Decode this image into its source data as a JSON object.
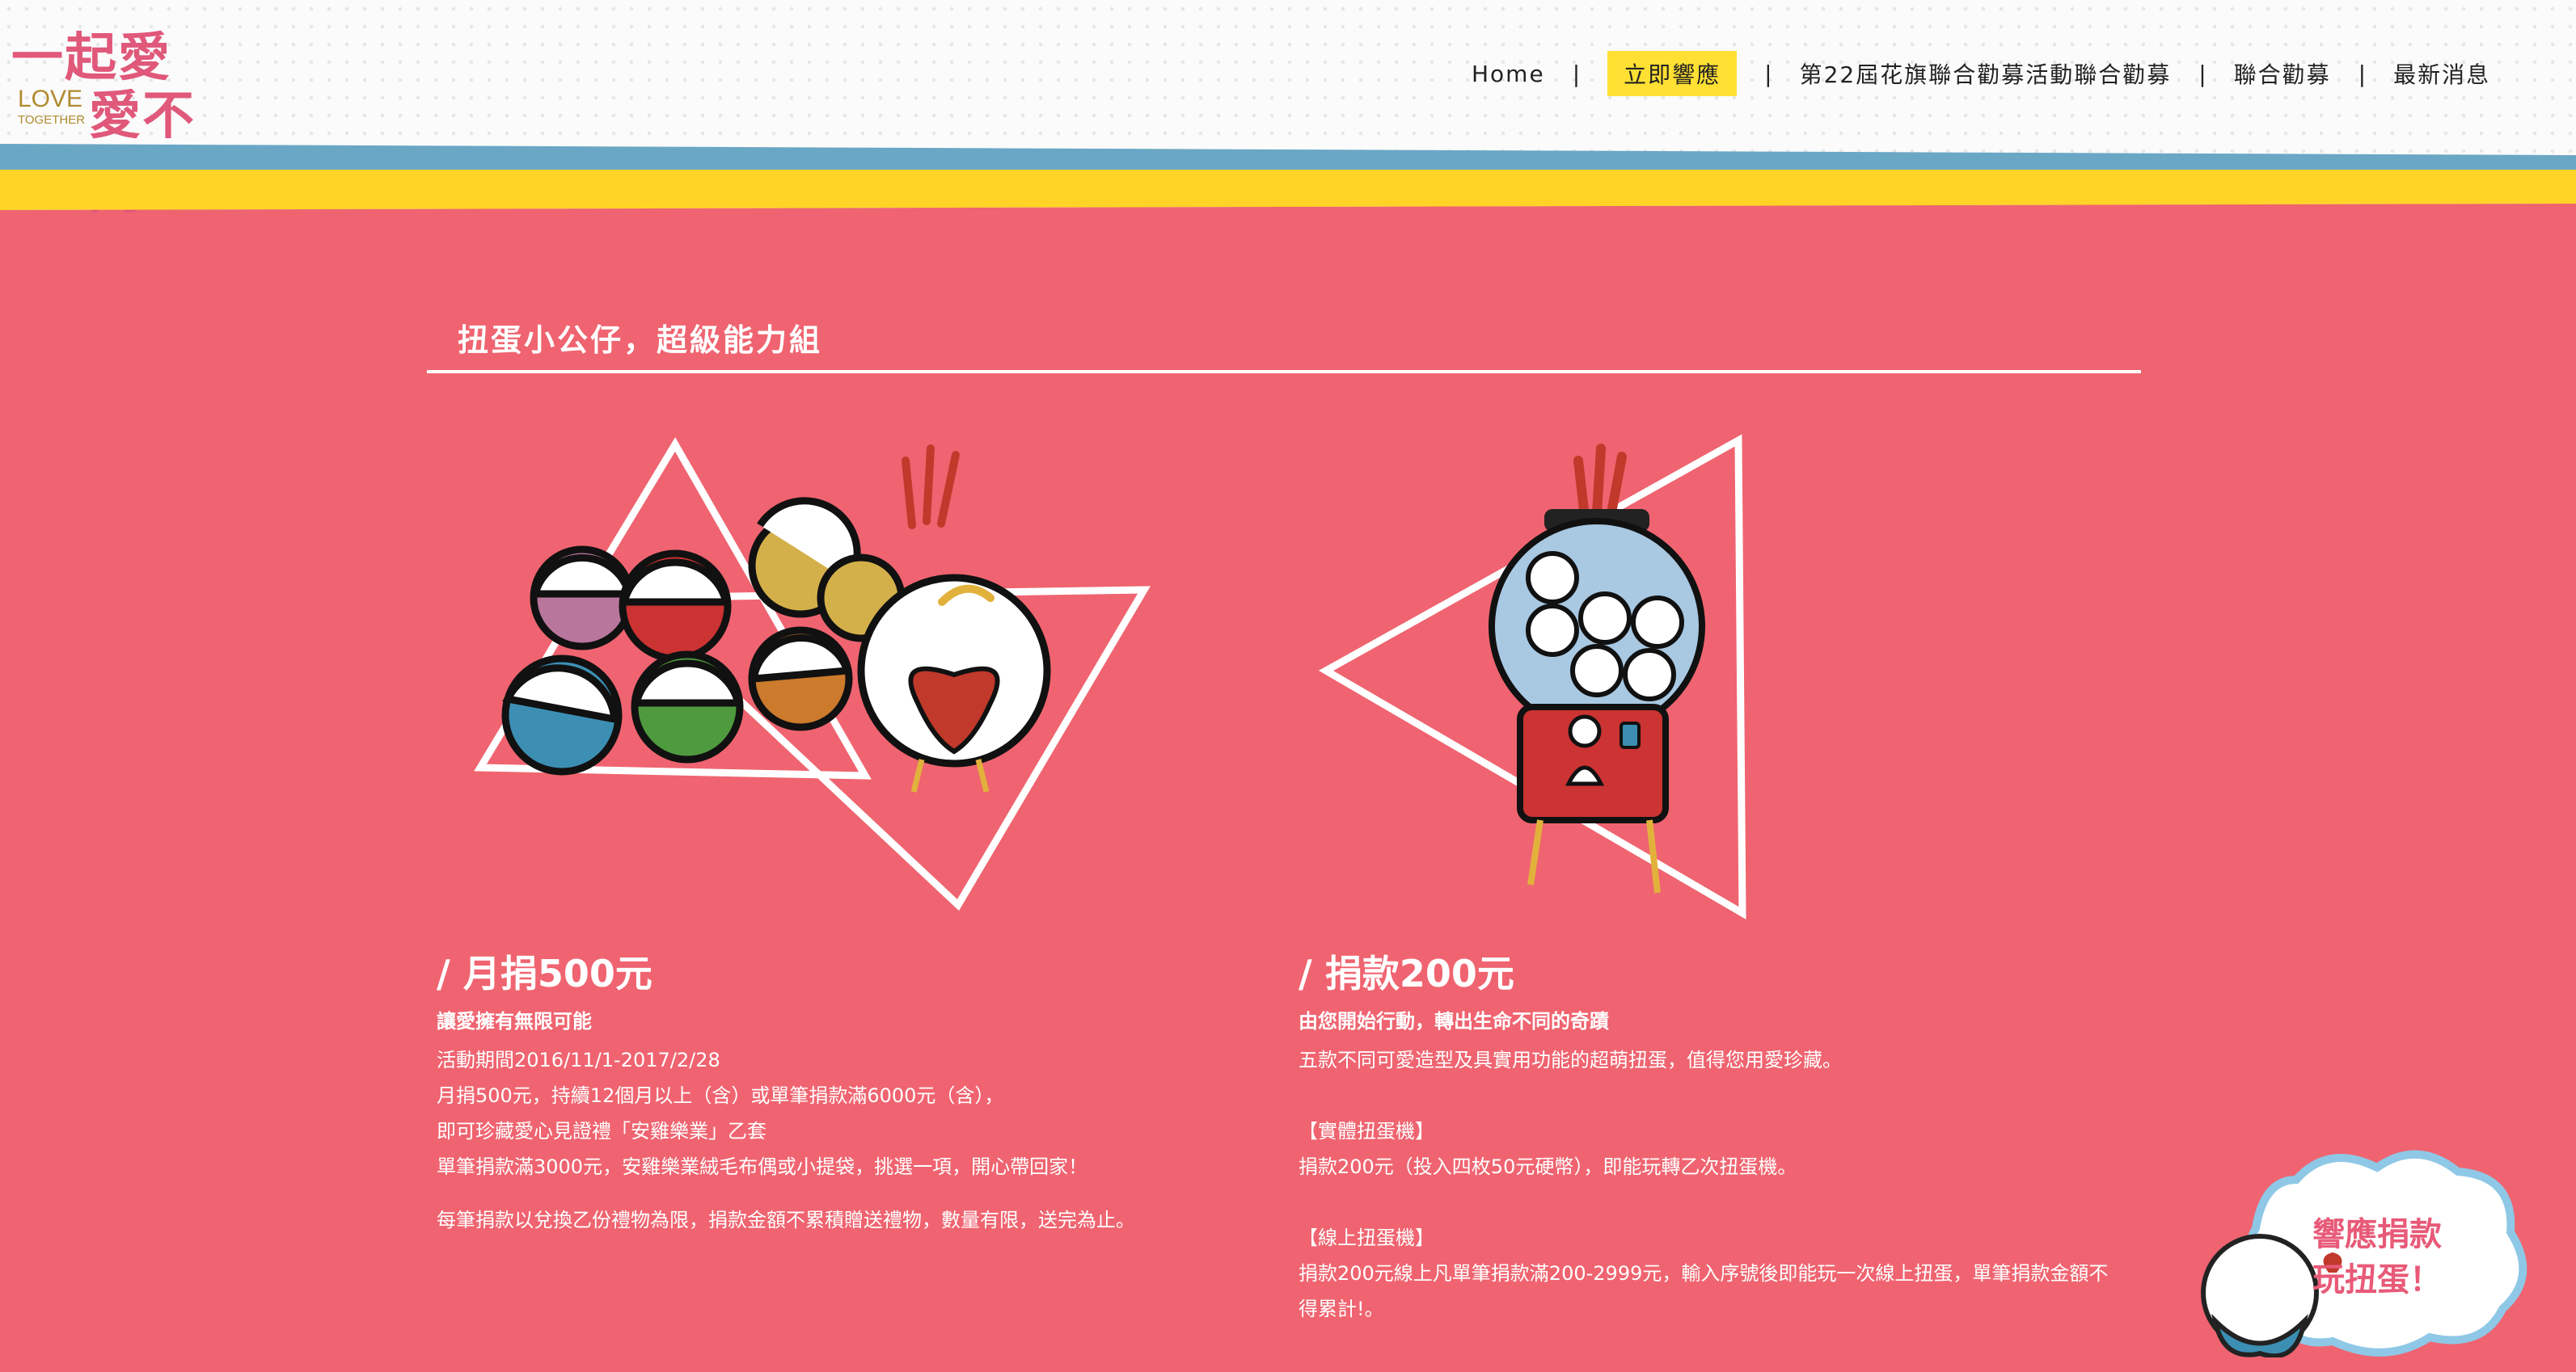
{
  "logo": {
    "line1": "一起愛",
    "line2": "愛不同",
    "love": "LOVE",
    "together": "TOGETHER"
  },
  "nav": {
    "items": [
      {
        "label": "Home"
      },
      {
        "label": "立即響應",
        "active": true
      },
      {
        "label": "第22屆花旗聯合勸募活動聯合勸募"
      },
      {
        "label": "聯合勸募"
      },
      {
        "label": "最新消息"
      }
    ],
    "separator": "|"
  },
  "colors": {
    "background": "#ef6470",
    "header_stripe_yellow": "#ffd426",
    "header_stripe_blue": "#6aa7c5",
    "nav_active": "#ffe033"
  },
  "section": {
    "title": "扭蛋小公仔，超級能力組"
  },
  "left": {
    "heading": "/ 月捐500元",
    "subheading": "讓愛擁有無限可能",
    "lines": [
      "活動期間2016/11/1-2017/2/28",
      "月捐500元，持續12個月以上（含）或單筆捐款滿6000元（含），",
      "即可珍藏愛心見證禮「安雞樂業」乙套",
      "單筆捐款滿3000元，安雞樂業絨毛布偶或小提袋，挑選一項，開心帶回家！"
    ],
    "note": "每筆捐款以兌換乙份禮物為限，捐款金額不累積贈送禮物，數量有限，送完為止。"
  },
  "right": {
    "heading": "/ 捐款200元",
    "subheading": "由您開始行動，轉出生命不同的奇蹟",
    "intro": "五款不同可愛造型及具實用功能的超萌扭蛋，值得您用愛珍藏。",
    "physical_title": "【實體扭蛋機】",
    "physical_text": "捐款200元（投入四枚50元硬幣），即能玩轉乙次扭蛋機。",
    "online_title": "【線上扭蛋機】",
    "online_text": "捐款200元線上凡單筆捐款滿200-2999元，輸入序號後即能玩一次線上扭蛋，單筆捐款金額不得累計!。"
  },
  "badge": {
    "line1": "響應捐款",
    "line2": "玩扭蛋！"
  }
}
